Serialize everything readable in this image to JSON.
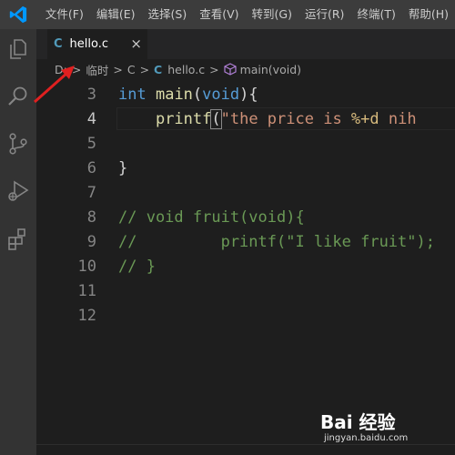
{
  "menu": [
    "文件(F)",
    "编辑(E)",
    "选择(S)",
    "查看(V)",
    "转到(G)",
    "运行(R)",
    "终端(T)",
    "帮助(H)"
  ],
  "tab": {
    "icon_letter": "C",
    "filename": "hello.c",
    "close": "×"
  },
  "breadcrumb": {
    "drive": "D:",
    "folder": "临时",
    "subfolder": "C",
    "file_icon": "C",
    "file": "hello.c",
    "symbol": "main(void)"
  },
  "editor": {
    "line_numbers": [
      "3",
      "4",
      "5",
      "6",
      "7",
      "8",
      "9",
      "10",
      "11",
      "12"
    ],
    "active_line": "4",
    "lines": {
      "l3": {
        "kw": "int",
        "sp": " ",
        "fn": "main",
        "p1": "(",
        "kw2": "void",
        "p2": "){"
      },
      "l4": {
        "indent": "    ",
        "fn": "printf",
        "paren": "(",
        "str1": "\"the price is ",
        "fmt": "%+d",
        "str2": " nih"
      },
      "l6": "}",
      "l8": "// void fruit(void){",
      "l9": "//         printf(\"I like fruit\");",
      "l10": "// }"
    }
  },
  "watermark": {
    "brand": "Bai 经验",
    "url": "jingyan.baidu.com"
  },
  "colors": {
    "accent": "#007acc",
    "arrow": "#e02020",
    "keyword": "#569cd6",
    "function": "#dcdcaa",
    "string": "#ce9178",
    "comment": "#6a9955"
  }
}
